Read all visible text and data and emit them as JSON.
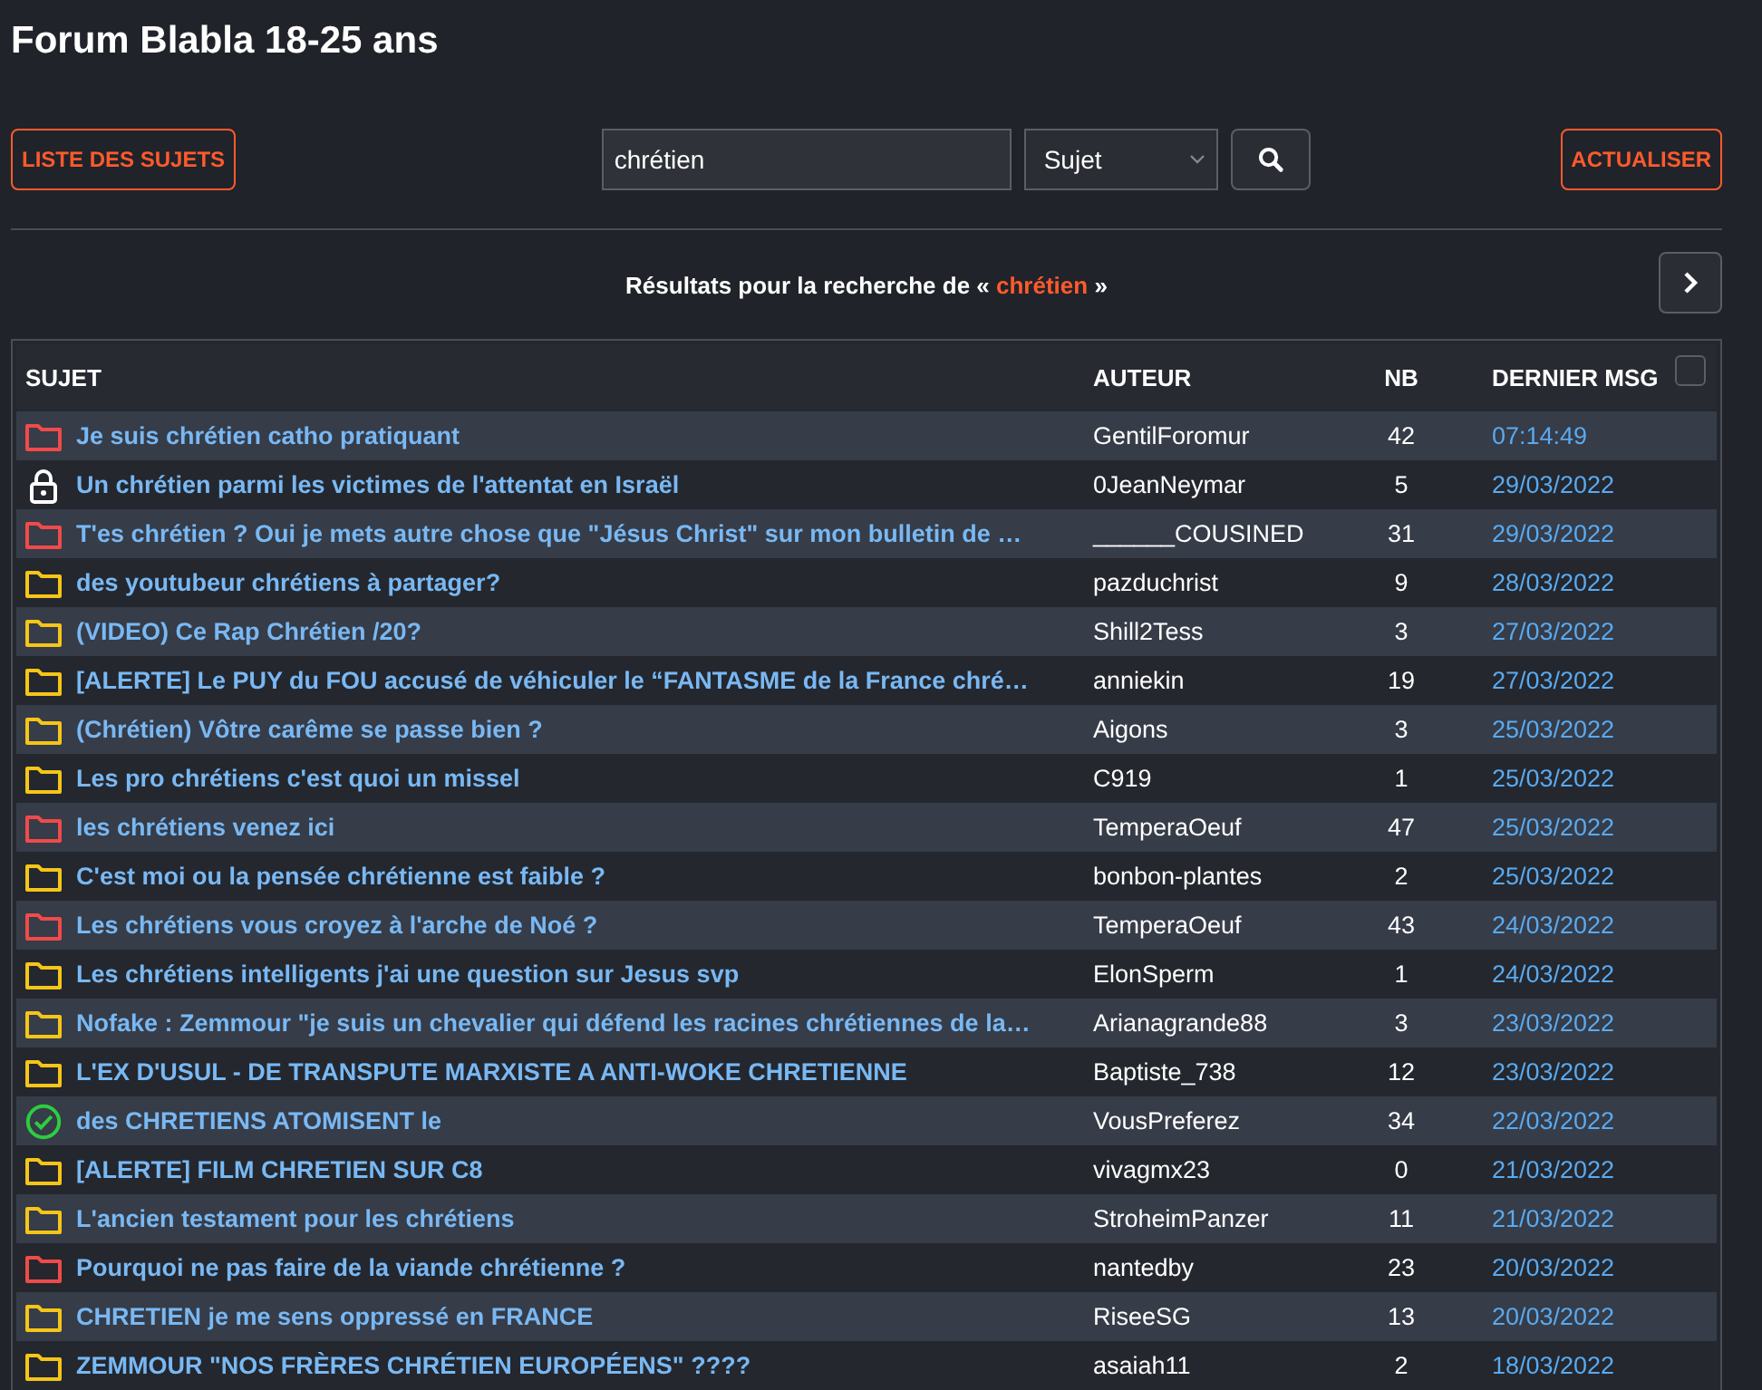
{
  "title": "Forum Blabla 18-25 ans",
  "toolbar": {
    "list_button": "LISTE DES SUJETS",
    "search": {
      "value": "chrétien"
    },
    "scope": {
      "value": "Sujet"
    },
    "refresh_button": "ACTUALISER"
  },
  "results": {
    "prefix": "Résultats pour la recherche de «",
    "term": "chrétien",
    "suffix": "»"
  },
  "table": {
    "columns": [
      "SUJET",
      "AUTEUR",
      "NB",
      "DERNIER MSG"
    ],
    "select_all": {
      "checked": false
    },
    "rows": [
      {
        "kind": "hot",
        "subject": "Je suis chrétien catho pratiquant",
        "author": "GentilForomur",
        "count": "42",
        "last": "07:14:49"
      },
      {
        "kind": "locked",
        "subject": "Un chrétien parmi les victimes de l'attentat en Israël",
        "author": "0JeanNeymar",
        "count": "5",
        "last": "29/03/2022"
      },
      {
        "kind": "hot",
        "subject": "T'es chrétien ? Oui je mets autre chose que \"Jésus Christ\" sur mon bulletin de …",
        "author": "______COUSINED",
        "count": "31",
        "last": "29/03/2022"
      },
      {
        "kind": "normal",
        "subject": "des youtubeur chrétiens à partager?",
        "author": "pazduchrist",
        "count": "9",
        "last": "28/03/2022"
      },
      {
        "kind": "normal",
        "subject": "(VIDEO) Ce Rap Chrétien /20?",
        "author": "Shill2Tess",
        "count": "3",
        "last": "27/03/2022"
      },
      {
        "kind": "normal",
        "subject": "[ALERTE] Le PUY du FOU accusé de véhiculer le “FANTASME de la France chré…",
        "author": "anniekin",
        "count": "19",
        "last": "27/03/2022"
      },
      {
        "kind": "normal",
        "subject": "(Chrétien) Vôtre carême se passe bien ?",
        "author": "Aigons",
        "count": "3",
        "last": "25/03/2022"
      },
      {
        "kind": "normal",
        "subject": "Les pro chrétiens c'est quoi un missel",
        "author": "C919",
        "count": "1",
        "last": "25/03/2022"
      },
      {
        "kind": "hot",
        "subject": "les chrétiens venez ici",
        "author": "TemperaOeuf",
        "count": "47",
        "last": "25/03/2022"
      },
      {
        "kind": "normal",
        "subject": "C'est moi ou la pensée chrétienne est faible ?",
        "author": "bonbon-plantes",
        "count": "2",
        "last": "25/03/2022"
      },
      {
        "kind": "hot",
        "subject": "Les chrétiens vous croyez à l'arche de Noé ?",
        "author": "TemperaOeuf",
        "count": "43",
        "last": "24/03/2022"
      },
      {
        "kind": "normal",
        "subject": "Les chrétiens intelligents j'ai une question sur Jesus svp",
        "author": "ElonSperm",
        "count": "1",
        "last": "24/03/2022"
      },
      {
        "kind": "normal",
        "subject": "Nofake : Zemmour \"je suis un chevalier qui défend les racines chrétiennes de la…",
        "author": "Arianagrande88",
        "count": "3",
        "last": "23/03/2022"
      },
      {
        "kind": "normal",
        "subject": "L'EX D'USUL - DE TRANSPUTE MARXISTE A ANTI-WOKE CHRETIENNE",
        "author": "Baptiste_738",
        "count": "12",
        "last": "23/03/2022"
      },
      {
        "kind": "resolved",
        "subject": "des CHRETIENS ATOMISENT le",
        "author": "VousPreferez",
        "count": "34",
        "last": "22/03/2022"
      },
      {
        "kind": "normal",
        "subject": "[ALERTE] FILM CHRETIEN SUR C8",
        "author": "vivagmx23",
        "count": "0",
        "last": "21/03/2022"
      },
      {
        "kind": "normal",
        "subject": "L'ancien testament pour les chrétiens",
        "author": "StroheimPanzer",
        "count": "11",
        "last": "21/03/2022"
      },
      {
        "kind": "hot",
        "subject": "Pourquoi ne pas faire de la viande chrétienne ?",
        "author": "nantedby",
        "count": "23",
        "last": "20/03/2022"
      },
      {
        "kind": "normal",
        "subject": "CHRETIEN je me sens oppressé en FRANCE",
        "author": "RiseeSG",
        "count": "13",
        "last": "20/03/2022"
      },
      {
        "kind": "normal",
        "subject": "ZEMMOUR \"NOS FRÈRES CHRÉTIEN EUROPÉENS\" ????",
        "author": "asaiah11",
        "count": "2",
        "last": "18/03/2022"
      }
    ]
  }
}
